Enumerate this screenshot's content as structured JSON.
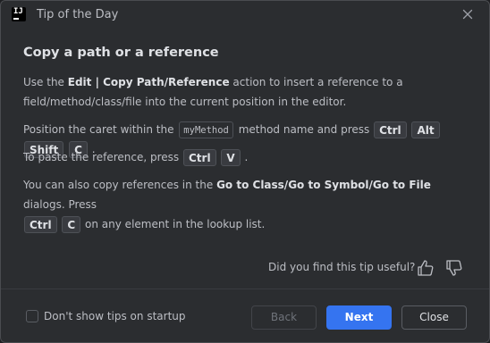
{
  "window": {
    "title": "Tip of the Day",
    "app_icon_text": "IJ"
  },
  "tip": {
    "heading": "Copy a path or a reference",
    "p1": {
      "pre": "Use the ",
      "action": "Edit | Copy Path/Reference",
      "post": " action to insert a reference to a field/method/class/file into the current position in the editor."
    },
    "p2": {
      "pre": "Position the caret within the ",
      "code": "myMethod",
      "mid": " method name and press ",
      "keys": [
        "Ctrl",
        "Alt",
        "Shift",
        "C"
      ],
      "post": "."
    },
    "p3": {
      "pre": "To paste the reference, press ",
      "keys": [
        "Ctrl",
        "V"
      ],
      "post": "."
    },
    "p4": {
      "pre": "You can also copy references in the ",
      "dialogs": "Go to Class/Go to Symbol/Go to File",
      "mid": " dialogs. Press ",
      "keys": [
        "Ctrl",
        "C"
      ],
      "post": " on any element in the lookup list."
    }
  },
  "feedback": {
    "question": "Did you find this tip useful?",
    "up_icon": "thumb-up-icon",
    "down_icon": "thumb-down-icon"
  },
  "footer": {
    "checkbox_label": "Don't show tips on startup",
    "checkbox_checked": false,
    "back_label": "Back",
    "next_label": "Next",
    "close_label": "Close"
  },
  "colors": {
    "background": "#2b2d30",
    "accent": "#3574f0",
    "text": "#bcbec4",
    "heading": "#dfe1e5"
  }
}
